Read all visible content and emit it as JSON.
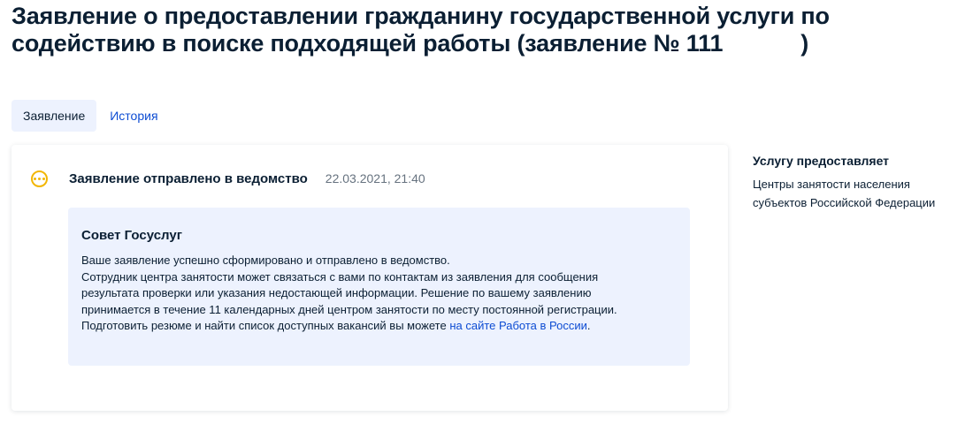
{
  "header": {
    "title_line1": "Заявление о предоставлении гражданину государственной услуги по",
    "title_line2": "содействию в поиске подходящей работы (заявление № 111",
    "title_close": ")"
  },
  "tabs": [
    {
      "label": "Заявление",
      "active": true
    },
    {
      "label": "История",
      "active": false
    }
  ],
  "status": {
    "text": "Заявление отправлено в ведомство",
    "datetime": "22.03.2021, 21:40",
    "icon": "more-dots-icon",
    "color": "#f2b604"
  },
  "advice": {
    "title": "Совет Госуслуг",
    "lines": [
      "Ваше заявление успешно сформировано и отправлено в ведомство.",
      "Сотрудник центра занятости может связаться с вами по контактам из заявления для сообщения",
      "результата проверки или указания недостающей информации. Решение по вашему заявлению",
      "принимается в течение 11 календарных дней центром занятости по месту постоянной регистрации."
    ],
    "last_line_prefix": "Подготовить резюме и найти список доступных вакансий вы можете ",
    "link_text": "на сайте Работа в России",
    "last_line_suffix": "."
  },
  "sidebar": {
    "title": "Услугу предоставляет",
    "provider_line1": "Центры занятости населения",
    "provider_line2": "субъектов Российской Федерации"
  },
  "colors": {
    "link": "#0d4cd3",
    "panel": "#edf2fe",
    "warning": "#f2b604"
  }
}
